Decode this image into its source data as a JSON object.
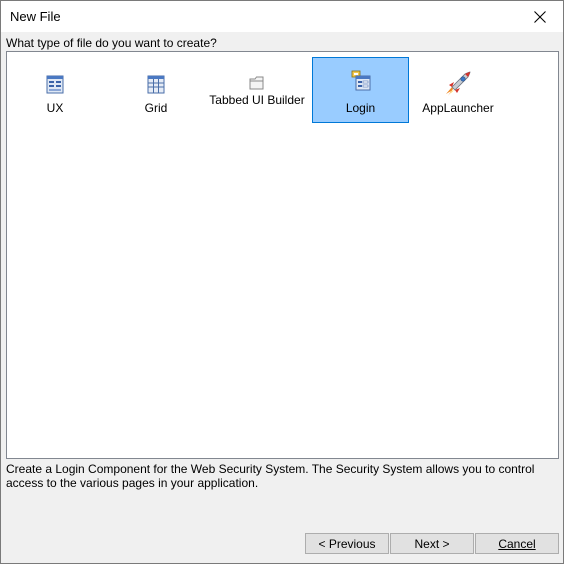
{
  "window": {
    "title": "New File",
    "close_icon": "close-icon"
  },
  "prompt": "What type of file do you want to create?",
  "items": [
    {
      "label": "UX",
      "icon": "ux-component-icon",
      "selected": false
    },
    {
      "label": "Grid",
      "icon": "grid-component-icon",
      "selected": false
    },
    {
      "label": "Tabbed UI Builder",
      "icon": "folder-icon",
      "selected": false
    },
    {
      "label": "Login",
      "icon": "login-component-icon",
      "selected": true
    },
    {
      "label": "AppLauncher",
      "icon": "rocket-icon",
      "selected": false
    }
  ],
  "description": "Create a Login Component for the Web Security System. The Security System allows you to control access to the various pages in your application.",
  "buttons": {
    "previous": "< Previous",
    "next": "Next >",
    "cancel": "Cancel"
  },
  "colors": {
    "selection_fill": "#99ccff",
    "selection_border": "#0078d7",
    "dialog_bg": "#f0f0f0"
  }
}
